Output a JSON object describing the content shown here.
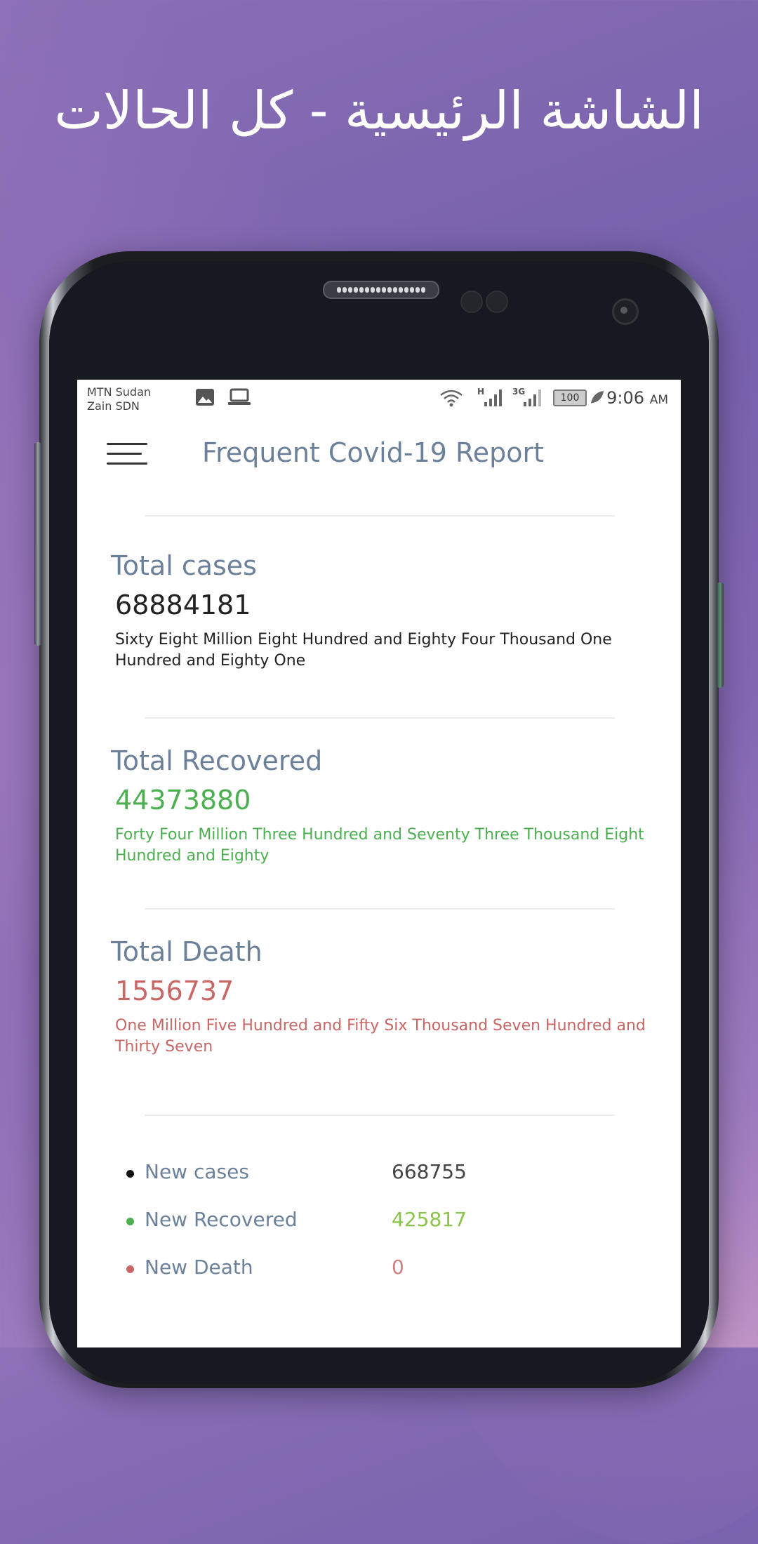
{
  "headline": "الشاشة الرئيسية - كل الحالات",
  "status_bar": {
    "carrier_1": "MTN Sudan",
    "carrier_2": "Zain SDN",
    "network_1": "H",
    "network_2": "3G",
    "battery": "100",
    "time": "9:06",
    "ampm": "AM",
    "icons": [
      "image-icon",
      "laptop-icon",
      "wifi-icon",
      "signal-icon",
      "signal-icon",
      "battery-icon",
      "leaf-icon"
    ]
  },
  "app_bar": {
    "title": "Frequent Covid-19 Report",
    "menu_icon": "menu-icon"
  },
  "totals": {
    "cases": {
      "label": "Total cases",
      "value": "68884181",
      "words": "Sixty Eight Million  Eight Hundred and Eighty Four Thousand One Hundred and Eighty One",
      "color": "#222222"
    },
    "recovered": {
      "label": "Total Recovered",
      "value": "44373880",
      "words": "Forty Four Million  Three Hundred and Seventy Three Thousand Eight Hundred and Eighty",
      "color": "#4caf50"
    },
    "death": {
      "label": "Total Death",
      "value": "1556737",
      "words": "One Million  Five Hundred and Fifty Six Thousand  Seven Hundred and Thirty Seven",
      "color": "#c96666"
    }
  },
  "new_stats": [
    {
      "label": "New cases",
      "value": "668755",
      "bullet_color": "#111111",
      "value_color": "#444444"
    },
    {
      "label": "New Recovered",
      "value": "425817",
      "bullet_color": "#4caf50",
      "value_color": "#8bc34a"
    },
    {
      "label": "New Death",
      "value": "0",
      "bullet_color": "#c96666",
      "value_color": "#d08080"
    }
  ]
}
